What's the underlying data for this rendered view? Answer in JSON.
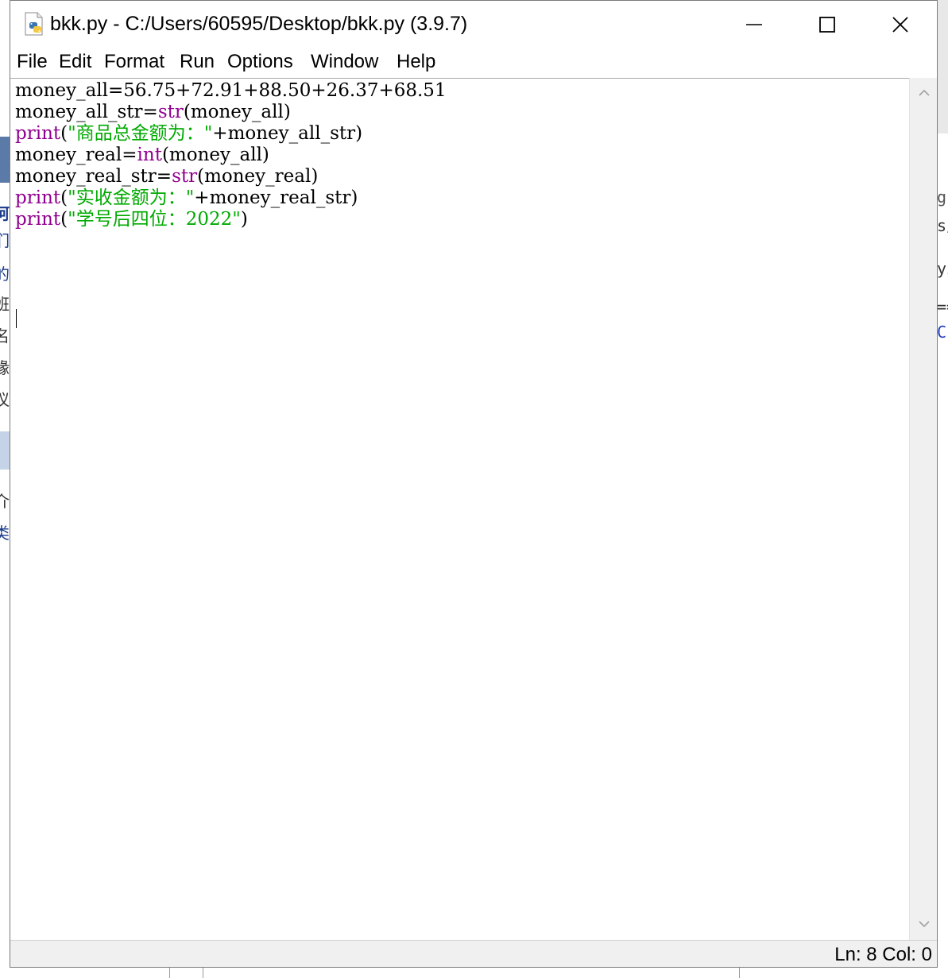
{
  "window": {
    "title": "bkk.py - C:/Users/60595/Desktop/bkk.py (3.9.7)",
    "app_icon": "python-file-icon",
    "controls": [
      "minimize-icon",
      "maximize-icon",
      "close-icon"
    ]
  },
  "menu": {
    "file": "File",
    "edit": "Edit",
    "format": "Format",
    "run": "Run",
    "options": "Options",
    "window": "Window",
    "help": "Help"
  },
  "code": {
    "lines": [
      [
        {
          "t": "money_all=56.75+72.91+88.50+26.37+68.51",
          "c": "plain"
        }
      ],
      [
        {
          "t": "money_all_str=",
          "c": "plain"
        },
        {
          "t": "str",
          "c": "kw"
        },
        {
          "t": "(money_all)",
          "c": "plain"
        }
      ],
      [
        {
          "t": "print",
          "c": "kw"
        },
        {
          "t": "(",
          "c": "plain"
        },
        {
          "t": "\"商品总金额为：\"",
          "c": "str"
        },
        {
          "t": "+money_all_str)",
          "c": "plain"
        }
      ],
      [
        {
          "t": "money_real=",
          "c": "plain"
        },
        {
          "t": "int",
          "c": "kw"
        },
        {
          "t": "(money_all)",
          "c": "plain"
        }
      ],
      [
        {
          "t": "money_real_str=",
          "c": "plain"
        },
        {
          "t": "str",
          "c": "kw"
        },
        {
          "t": "(money_real)",
          "c": "plain"
        }
      ],
      [
        {
          "t": "print",
          "c": "kw"
        },
        {
          "t": "(",
          "c": "plain"
        },
        {
          "t": "\"实收金额为：\"",
          "c": "str"
        },
        {
          "t": "+money_real_str)",
          "c": "plain"
        }
      ],
      [
        {
          "t": "print",
          "c": "kw"
        },
        {
          "t": "(",
          "c": "plain"
        },
        {
          "t": "\"学号后四位：2022\"",
          "c": "str"
        },
        {
          "t": ")",
          "c": "plain"
        }
      ]
    ],
    "syntax_colors": {
      "plain": "#000000",
      "kw": "#900090",
      "str": "#00aa00"
    }
  },
  "status": {
    "text": "Ln: 8  Col: 0"
  },
  "background": {
    "left_fragments": [
      "阿",
      "们",
      "的",
      "班",
      "名",
      "缘",
      "议",
      "介",
      "类"
    ],
    "right_fragments": [
      "g",
      "s/",
      "yı",
      "==",
      "C"
    ]
  }
}
